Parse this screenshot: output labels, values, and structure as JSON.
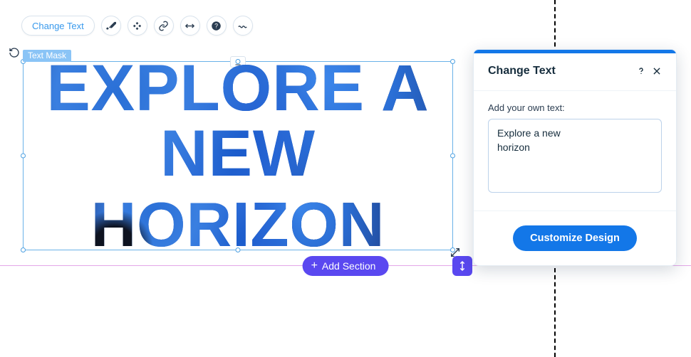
{
  "toolbar": {
    "change_text_label": "Change Text",
    "icons": {
      "brush": "brush",
      "animation": "animation",
      "link": "link",
      "stretch": "stretch-horizontal",
      "help": "help",
      "wave": "wave"
    }
  },
  "element": {
    "tag_label": "Text Mask",
    "line1": "EXPLORE A NEW",
    "line2": "HORIZON",
    "overlap_icon": "download"
  },
  "section": {
    "add_label": "Add Section"
  },
  "panel": {
    "title": "Change Text",
    "help_icon": "help",
    "close_icon": "close",
    "field_label": "Add your own text:",
    "textarea_value": "Explore a new\nhorizon",
    "cta_label": "Customize Design"
  }
}
